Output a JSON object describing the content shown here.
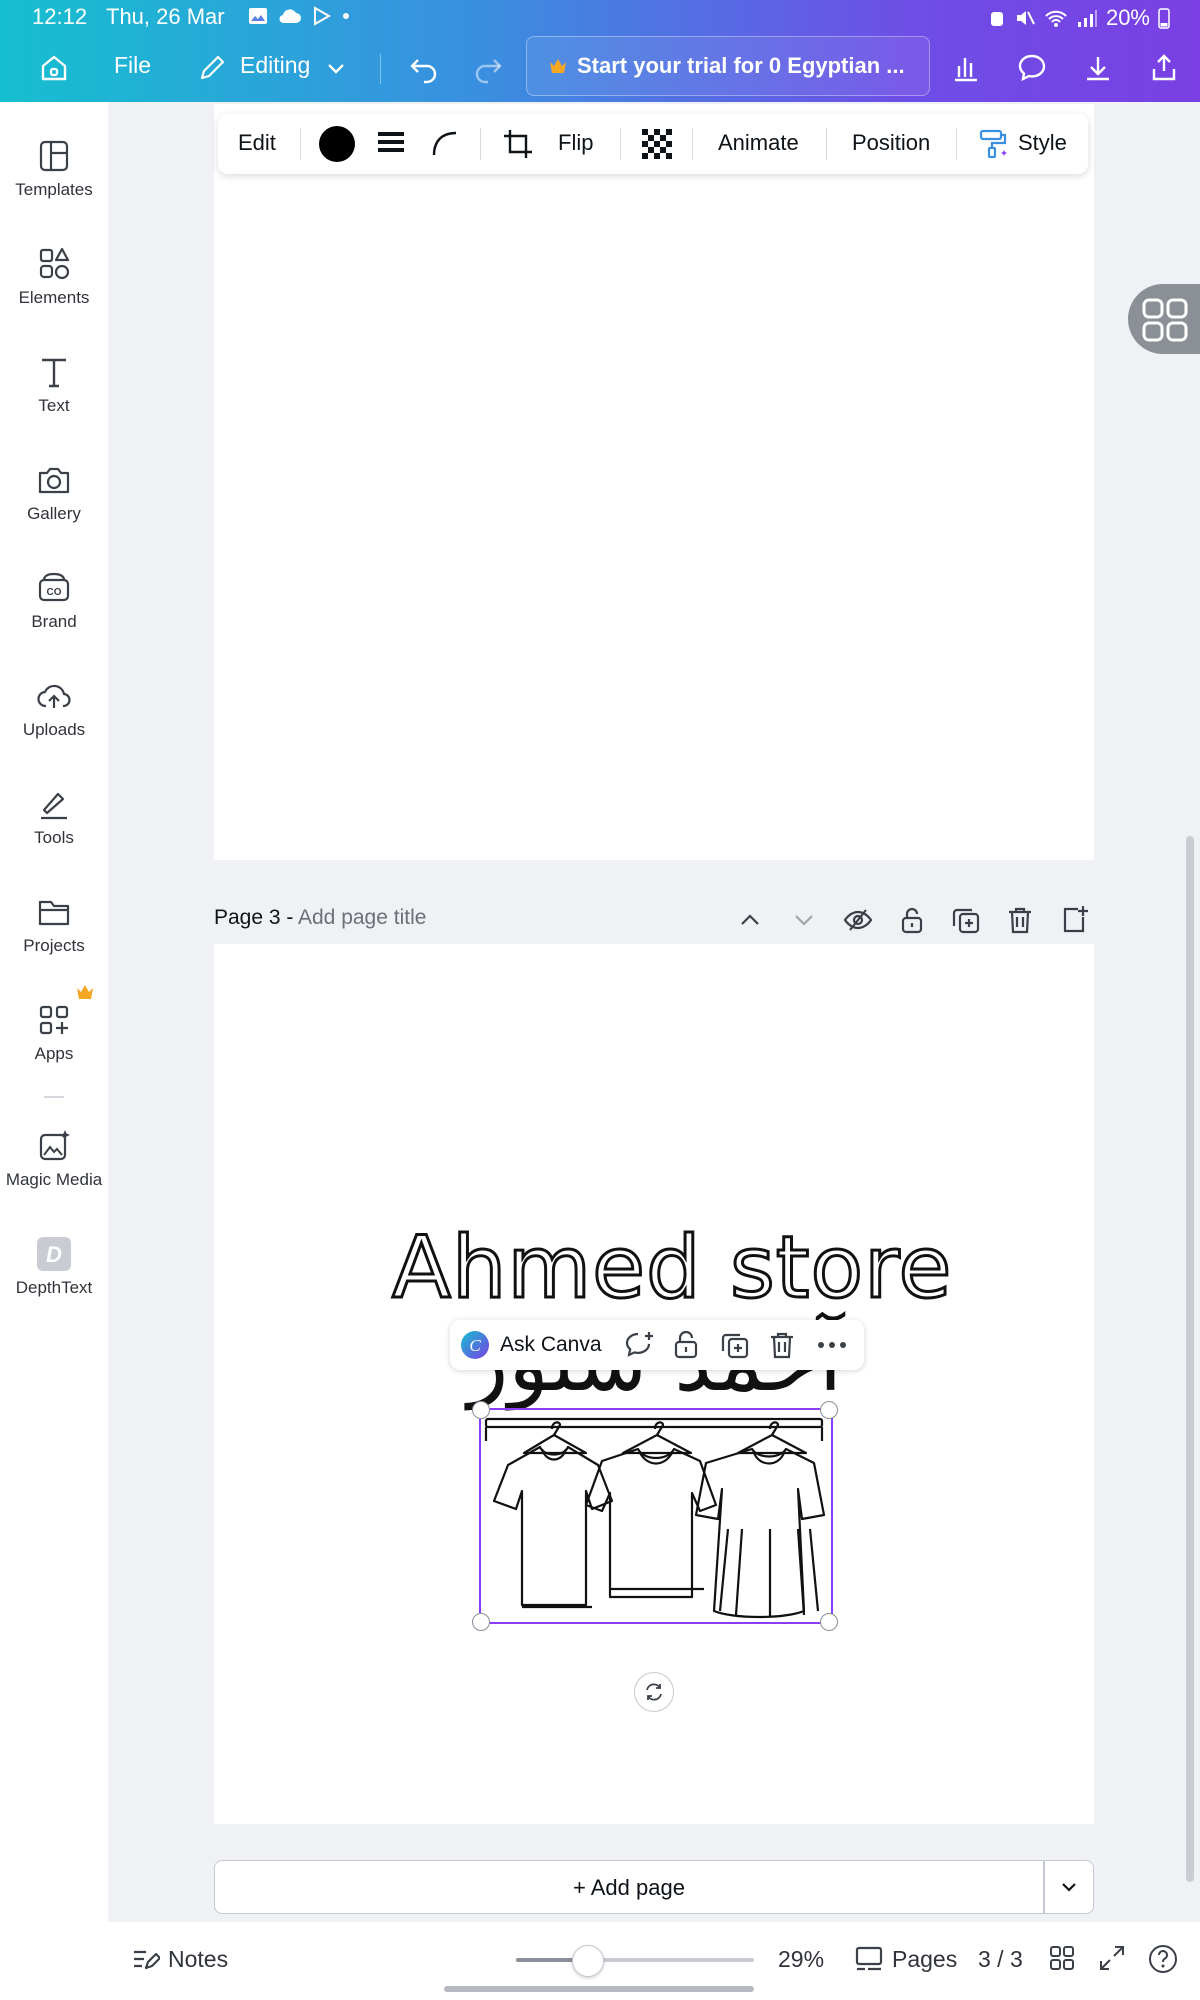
{
  "status": {
    "time": "12:12",
    "date": "Thu, 26 Mar",
    "battery": "20%"
  },
  "toolbar": {
    "file_label": "File",
    "editing_label": "Editing",
    "trial_label": "Start your trial for 0 Egyptian ..."
  },
  "sidebar": {
    "items": [
      {
        "label": "Templates",
        "icon": "templates-icon"
      },
      {
        "label": "Elements",
        "icon": "elements-icon"
      },
      {
        "label": "Text",
        "icon": "text-icon"
      },
      {
        "label": "Gallery",
        "icon": "camera-icon"
      },
      {
        "label": "Brand",
        "icon": "brand-icon"
      },
      {
        "label": "Uploads",
        "icon": "upload-cloud-icon"
      },
      {
        "label": "Tools",
        "icon": "tools-icon"
      },
      {
        "label": "Projects",
        "icon": "folder-icon"
      },
      {
        "label": "Apps",
        "icon": "apps-icon"
      },
      {
        "label": "Magic Media",
        "icon": "magic-media-icon"
      },
      {
        "label": "DepthText",
        "icon": "depthtext-icon"
      }
    ]
  },
  "context_toolbar": {
    "edit": "Edit",
    "flip": "Flip",
    "animate": "Animate",
    "position": "Position",
    "style": "Style"
  },
  "page3": {
    "label": "Page 3 -",
    "title_placeholder": "Add page title",
    "heading": "Ahmed store",
    "arabic_text": "آحمد ستور"
  },
  "ask_canva": {
    "label": "Ask Canva"
  },
  "add_page": {
    "label": "+ Add page"
  },
  "bottom": {
    "notes_label": "Notes",
    "zoom": "29%",
    "zoom_fraction": 0.3,
    "pages_label": "Pages",
    "page_count": "3 / 3"
  },
  "colors": {
    "accent": "#8b3dff",
    "crown": "#f5a623"
  }
}
